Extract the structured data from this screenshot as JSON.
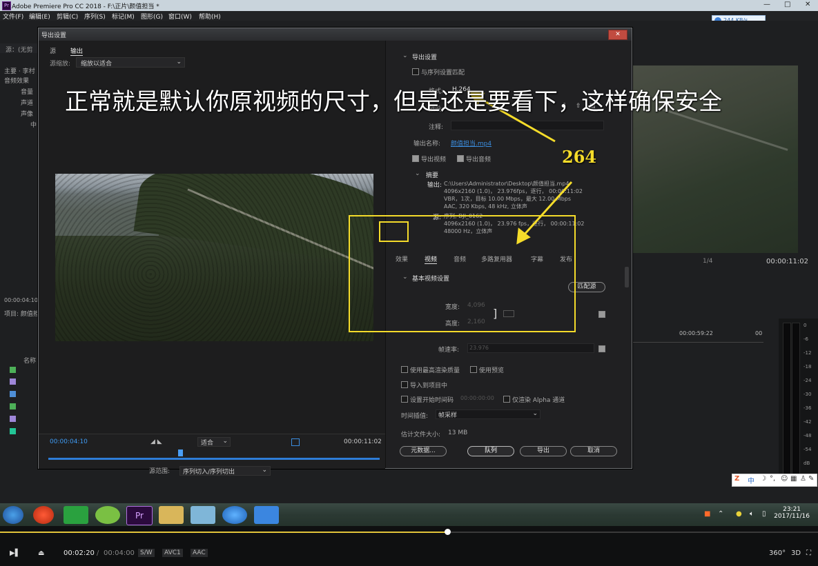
{
  "window": {
    "app_icon": "Pr",
    "title": "Adobe Premiere Pro CC 2018 - F:\\正片\\颜值担当 *",
    "controls": [
      "—",
      "□",
      "✕"
    ]
  },
  "menu": [
    "文件(F)",
    "编辑(E)",
    "剪辑(C)",
    "序列(S)",
    "标记(M)",
    "图形(G)",
    "窗口(W)",
    "帮助(H)"
  ],
  "speed_widget": {
    "label": "244 KB/s",
    "icon": "cloud-download-icon"
  },
  "left_panel": {
    "source_label": "源：(无剪",
    "effects_rows": [
      "主要 · 李村",
      "音频效果",
      "音量",
      "声道",
      "声像",
      "中"
    ],
    "time": "00:00:04:10",
    "project_label": "项目: 颜值担",
    "name_col": "名称",
    "swatch_colors": [
      "#4db058",
      "#9e86d8",
      "#4e8ed6",
      "#4db058",
      "#9e86d8",
      "#23c596"
    ]
  },
  "dialog": {
    "title": "导出设置",
    "close": "✕",
    "tabs": {
      "source": "源",
      "output": "输出"
    },
    "source_scale_label": "源缩放:",
    "source_scale_value": "缩放以适合",
    "timecode_in": "00:00:04:10",
    "timecode_out": "00:00:11:02",
    "fit_value": "适合",
    "range_label": "源范围:",
    "range_value": "序列切入/序列切出",
    "export_settings": {
      "header": "导出设置",
      "match_sequence": "与序列设置匹配",
      "format_label": "格式:",
      "format_value": "H.264",
      "preset_label": "预设:",
      "comments_label": "注释:",
      "output_name_label": "输出名称:",
      "output_name_value": "颜值担当.mp4",
      "export_video": "导出视频",
      "export_audio": "导出音频",
      "summary_header": "摘要",
      "output_label": "输出:",
      "output_lines": [
        "C:\\Users\\Administrator\\Desktop\\颜值担当.mp4",
        "4096x2160 (1.0)， 23.976fps，逐行， 00:00:11:02",
        "VBR，1次，目标 10.00 Mbps，最大 12.00 Mbps",
        "AAC, 320 Kbps, 48 kHz, 立体声"
      ],
      "source_label": "源:",
      "source_lines": [
        "序列, DJI_0162",
        "4096x2160 (1.0)， 23.976 fps，逐行， 00:00:11:02",
        "48000 Hz，立体声"
      ]
    },
    "settings_tabs": [
      "效果",
      "视频",
      "音频",
      "多路复用器",
      "字幕",
      "发布"
    ],
    "basic_video": {
      "header": "基本视频设置",
      "match_source": "匹配源",
      "width_label": "宽度:",
      "width_value": "4,096",
      "height_label": "高度:",
      "height_value": "2,160",
      "framerate_label": "帧速率:",
      "framerate_value": "23.976"
    },
    "options": {
      "max_render": "使用最高渲染质量",
      "use_previews": "使用预览",
      "import_project": "导入到项目中",
      "set_start_tc": "设置开始时间码",
      "start_tc_value": "00:00:00:00",
      "render_alpha": "仅渲染 Alpha 通道",
      "interp_label": "时间插值:",
      "interp_value": "帧采样",
      "filesize_label": "估计文件大小:",
      "filesize_value": "13 MB"
    },
    "buttons": {
      "metadata": "元数据...",
      "queue": "队列",
      "export": "导出",
      "cancel": "取消"
    }
  },
  "program_monitor": {
    "timecode": "00:00:11:02",
    "fit": "1/4"
  },
  "timeline": {
    "ruler_time": "00:00:59:22",
    "ruler_time2": "00",
    "meter_scale": [
      "0",
      "-6",
      "-12",
      "-18",
      "-24",
      "-30",
      "-36",
      "-42",
      "-48",
      "-54",
      "dB"
    ]
  },
  "annotation": {
    "caption": "正常就是默认你原视频的尺寸，但是还是要看下，这样确保安全",
    "note": "264",
    "color": "#f5dc2a"
  },
  "ime": {
    "logo": "Z",
    "label": "中",
    "icons": [
      "moon-icon",
      "comma-icon",
      "smile-icon",
      "keyboard-icon",
      "person-icon",
      "wrench-icon"
    ]
  },
  "taskbar": {
    "clock_time": "23:21",
    "clock_date": "2017/11/16",
    "apps": [
      "windows-start-icon",
      "player-icon",
      "green-app-icon",
      "frog-app-icon",
      "premiere-icon",
      "explorer-icon",
      "notes-icon",
      "browser-icon",
      "baidu-cloud-icon"
    ]
  },
  "player": {
    "current": "00:02:20",
    "separator": "/",
    "total": "00:04:00",
    "tags": [
      "S/W",
      "AVC1",
      "AAC"
    ],
    "right_labels": [
      "360°",
      "3D"
    ],
    "progress_fraction": 0.547
  }
}
